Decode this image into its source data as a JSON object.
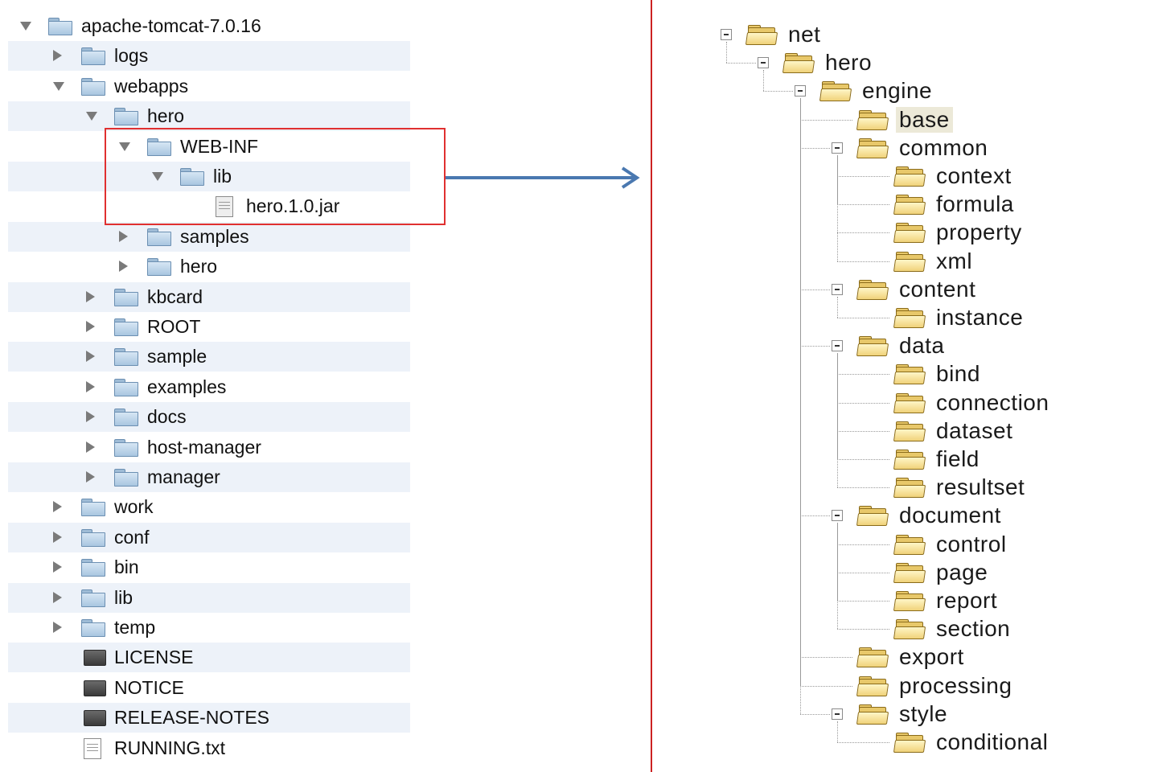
{
  "finder": {
    "rows": [
      {
        "label": "apache-tomcat-7.0.16",
        "level": 0,
        "toggle": "open",
        "icon": "folder"
      },
      {
        "label": "logs",
        "level": 1,
        "toggle": "closed",
        "icon": "folder"
      },
      {
        "label": "webapps",
        "level": 1,
        "toggle": "open",
        "icon": "folder"
      },
      {
        "label": "hero",
        "level": 2,
        "toggle": "open",
        "icon": "folder"
      },
      {
        "label": "WEB-INF",
        "level": 3,
        "toggle": "open",
        "icon": "folder"
      },
      {
        "label": "lib",
        "level": 4,
        "toggle": "open",
        "icon": "folder"
      },
      {
        "label": "hero.1.0.jar",
        "level": 5,
        "toggle": "none",
        "icon": "jar"
      },
      {
        "label": "samples",
        "level": 3,
        "toggle": "closed",
        "icon": "folder"
      },
      {
        "label": "hero",
        "level": 3,
        "toggle": "closed",
        "icon": "folder"
      },
      {
        "label": "kbcard",
        "level": 2,
        "toggle": "closed",
        "icon": "folder"
      },
      {
        "label": "ROOT",
        "level": 2,
        "toggle": "closed",
        "icon": "folder"
      },
      {
        "label": "sample",
        "level": 2,
        "toggle": "closed",
        "icon": "folder"
      },
      {
        "label": "examples",
        "level": 2,
        "toggle": "closed",
        "icon": "folder"
      },
      {
        "label": "docs",
        "level": 2,
        "toggle": "closed",
        "icon": "folder"
      },
      {
        "label": "host-manager",
        "level": 2,
        "toggle": "closed",
        "icon": "folder"
      },
      {
        "label": "manager",
        "level": 2,
        "toggle": "closed",
        "icon": "folder"
      },
      {
        "label": "work",
        "level": 1,
        "toggle": "closed",
        "icon": "folder"
      },
      {
        "label": "conf",
        "level": 1,
        "toggle": "closed",
        "icon": "folder"
      },
      {
        "label": "bin",
        "level": 1,
        "toggle": "closed",
        "icon": "folder"
      },
      {
        "label": "lib",
        "level": 1,
        "toggle": "closed",
        "icon": "folder"
      },
      {
        "label": "temp",
        "level": 1,
        "toggle": "closed",
        "icon": "folder"
      },
      {
        "label": "LICENSE",
        "level": 1,
        "toggle": "none",
        "icon": "exec"
      },
      {
        "label": "NOTICE",
        "level": 1,
        "toggle": "none",
        "icon": "exec"
      },
      {
        "label": "RELEASE-NOTES",
        "level": 1,
        "toggle": "none",
        "icon": "exec"
      },
      {
        "label": "RUNNING.txt",
        "level": 1,
        "toggle": "none",
        "icon": "doc"
      }
    ]
  },
  "package_tree": {
    "selected": "base",
    "nodes": [
      {
        "label": "net",
        "level": 0,
        "expanded": true
      },
      {
        "label": "hero",
        "level": 1,
        "expanded": true
      },
      {
        "label": "engine",
        "level": 2,
        "expanded": true
      },
      {
        "label": "base",
        "level": 3,
        "expanded": false
      },
      {
        "label": "common",
        "level": 3,
        "expanded": true
      },
      {
        "label": "context",
        "level": 4,
        "expanded": false
      },
      {
        "label": "formula",
        "level": 4,
        "expanded": false
      },
      {
        "label": "property",
        "level": 4,
        "expanded": false
      },
      {
        "label": "xml",
        "level": 4,
        "expanded": false
      },
      {
        "label": "content",
        "level": 3,
        "expanded": true
      },
      {
        "label": "instance",
        "level": 4,
        "expanded": false
      },
      {
        "label": "data",
        "level": 3,
        "expanded": true
      },
      {
        "label": "bind",
        "level": 4,
        "expanded": false
      },
      {
        "label": "connection",
        "level": 4,
        "expanded": false
      },
      {
        "label": "dataset",
        "level": 4,
        "expanded": false
      },
      {
        "label": "field",
        "level": 4,
        "expanded": false
      },
      {
        "label": "resultset",
        "level": 4,
        "expanded": false
      },
      {
        "label": "document",
        "level": 3,
        "expanded": true
      },
      {
        "label": "control",
        "level": 4,
        "expanded": false
      },
      {
        "label": "page",
        "level": 4,
        "expanded": false
      },
      {
        "label": "report",
        "level": 4,
        "expanded": false
      },
      {
        "label": "section",
        "level": 4,
        "expanded": false
      },
      {
        "label": "export",
        "level": 3,
        "expanded": false
      },
      {
        "label": "processing",
        "level": 3,
        "expanded": false
      },
      {
        "label": "style",
        "level": 3,
        "expanded": true
      },
      {
        "label": "conditional",
        "level": 4,
        "expanded": false
      }
    ]
  },
  "colors": {
    "highlight_box": "#e03030",
    "divider": "#cc2222",
    "arrow": "#4a78b0"
  }
}
